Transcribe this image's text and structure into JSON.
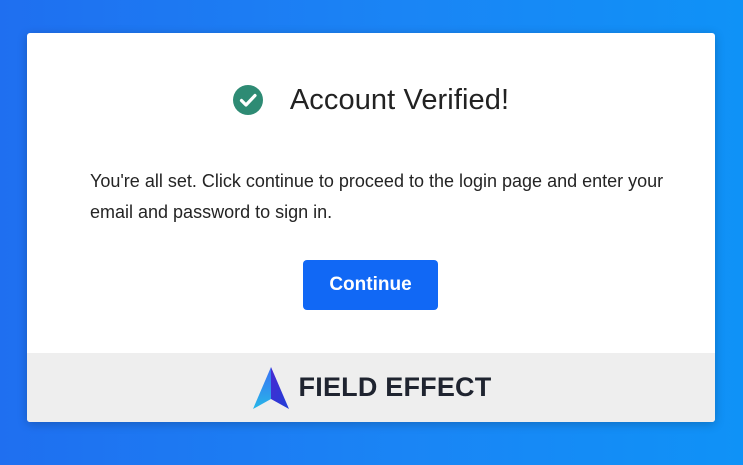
{
  "dialog": {
    "title": "Account Verified!",
    "message": "You're all set. Click continue to proceed to the login page and enter your email and password to sign in.",
    "continue_label": "Continue",
    "status_icon": "check-circle-icon"
  },
  "footer": {
    "brand_name": "FIELD EFFECT",
    "brand_logo": "field-effect-logo-icon"
  },
  "colors": {
    "background_start": "#1f6ff0",
    "background_end": "#0f92f7",
    "accent": "#1168f5",
    "success": "#2e8b74",
    "footer_bg": "#eeeeee"
  }
}
